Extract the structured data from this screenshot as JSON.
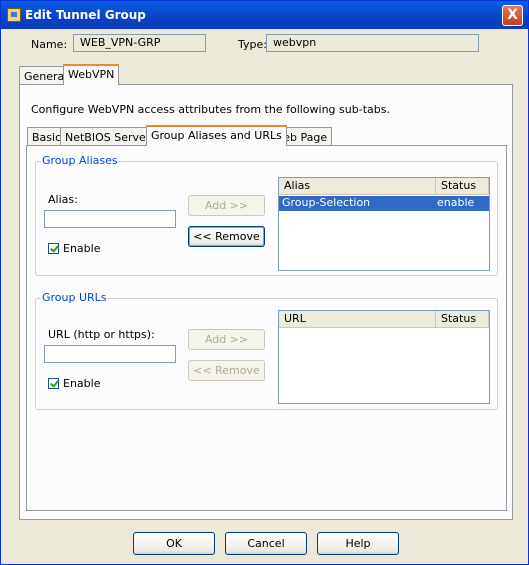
{
  "window": {
    "title": "Edit Tunnel Group",
    "close_label": "X"
  },
  "header": {
    "name_label": "Name:",
    "name_value": "WEB_VPN-GRP",
    "type_label": "Type:",
    "type_value": "webvpn"
  },
  "main_tabs": [
    {
      "label": "General",
      "active": false
    },
    {
      "label": "WebVPN",
      "active": true
    }
  ],
  "webvpn": {
    "description": "Configure WebVPN access attributes from the following sub-tabs.",
    "sub_tabs": [
      {
        "label": "Basic",
        "active": false
      },
      {
        "label": "NetBIOS Servers",
        "active": false
      },
      {
        "label": "Group Aliases and URLs",
        "active": true
      },
      {
        "label": "Web Page",
        "active": false
      }
    ]
  },
  "group_aliases": {
    "title": "Group Aliases",
    "alias_label": "Alias:",
    "alias_value": "",
    "enable_label": "Enable",
    "enable_checked": true,
    "add_label": "Add >>",
    "remove_label": "<< Remove",
    "table": {
      "columns": [
        "Alias",
        "Status"
      ],
      "rows": [
        {
          "alias": "Group-Selection",
          "status": "enable",
          "selected": true
        }
      ]
    }
  },
  "group_urls": {
    "title": "Group URLs",
    "url_label": "URL (http or https):",
    "url_value": "",
    "enable_label": "Enable",
    "enable_checked": true,
    "add_label": "Add >>",
    "remove_label": "<< Remove",
    "table": {
      "columns": [
        "URL",
        "Status"
      ],
      "rows": []
    }
  },
  "footer": {
    "ok_label": "OK",
    "cancel_label": "Cancel",
    "help_label": "Help"
  },
  "colors": {
    "titlebar": "#0a44c7",
    "group_title": "#0046d5",
    "selection": "#316ac5",
    "active_tab_accent": "#e68b2c"
  }
}
